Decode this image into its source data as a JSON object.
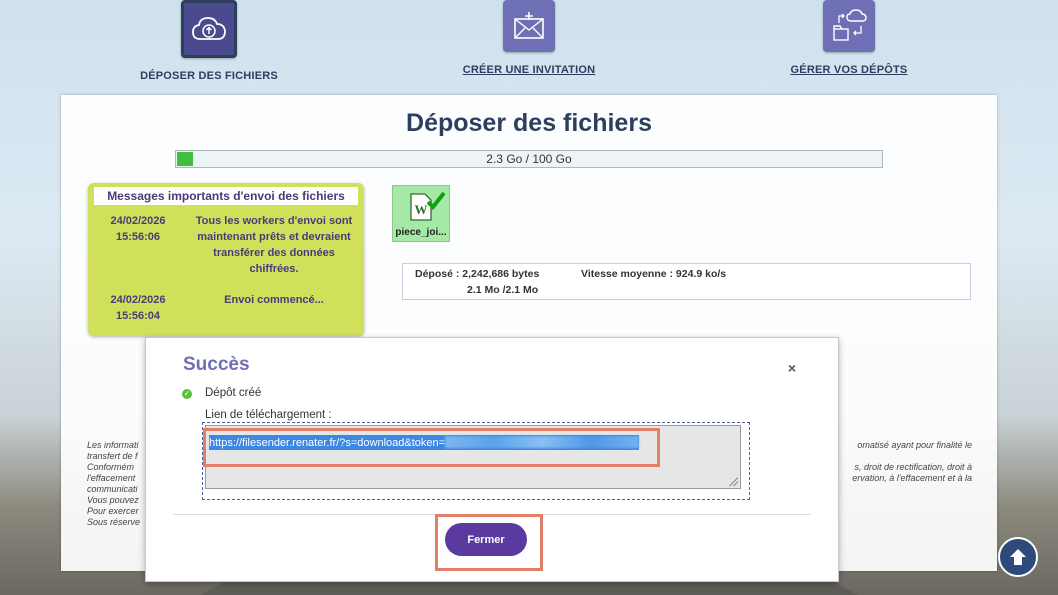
{
  "nav": {
    "items": [
      {
        "label": "DÉPOSER DES FICHIERS",
        "icon": "cloud-upload-icon",
        "active": true
      },
      {
        "label": "CRÉER UNE INVITATION",
        "icon": "envelope-plus-icon",
        "active": false
      },
      {
        "label": "GÉRER VOS DÉPÔTS",
        "icon": "manage-transfers-icon",
        "active": false
      }
    ]
  },
  "page": {
    "title": "Déposer des fichiers",
    "quota_text": "2.3 Go / 100 Go",
    "quota_fraction": 0.023
  },
  "messages": {
    "title": "Messages importants d'envoi des fichiers",
    "items": [
      {
        "date": "24/02/2026",
        "time": "15:56:06",
        "text": "Tous les workers d'envoi sont maintenant prêts et devraient transférer des données chiffrées."
      },
      {
        "date": "24/02/2026",
        "time": "15:56:04",
        "text": "Envoi commencé..."
      }
    ]
  },
  "file": {
    "name": "piece_joi...",
    "icon": "word-document-icon"
  },
  "stats": {
    "deposited_line1": "Déposé : 2,242,686 bytes",
    "deposited_line2": "2.1 Mo /2.1 Mo",
    "speed": "Vitesse moyenne : 924.9 ko/s"
  },
  "legal": {
    "left_lines": [
      "Les informati",
      "transfert de f",
      "Conformém",
      "l'effacement",
      "communicati",
      "Vous pouvez",
      "Pour exercer",
      "Sous réserve"
    ],
    "right_lines": [
      "omatisé ayant pour finalité le",
      "",
      "s, droit de rectification, droit à",
      "ervation, à l'effacement et à la"
    ]
  },
  "dialog": {
    "title": "Succès",
    "close": "×",
    "status": "Dépôt créé",
    "link_label": "Lien de téléchargement :",
    "link_value": "https://filesender.renater.fr/?s=download&token=",
    "button": "Fermer"
  },
  "colors": {
    "accent": "#6f6fb5",
    "button": "#5a3aa0",
    "messages_bg": "#d1e05a",
    "highlight": "#e0806a"
  }
}
